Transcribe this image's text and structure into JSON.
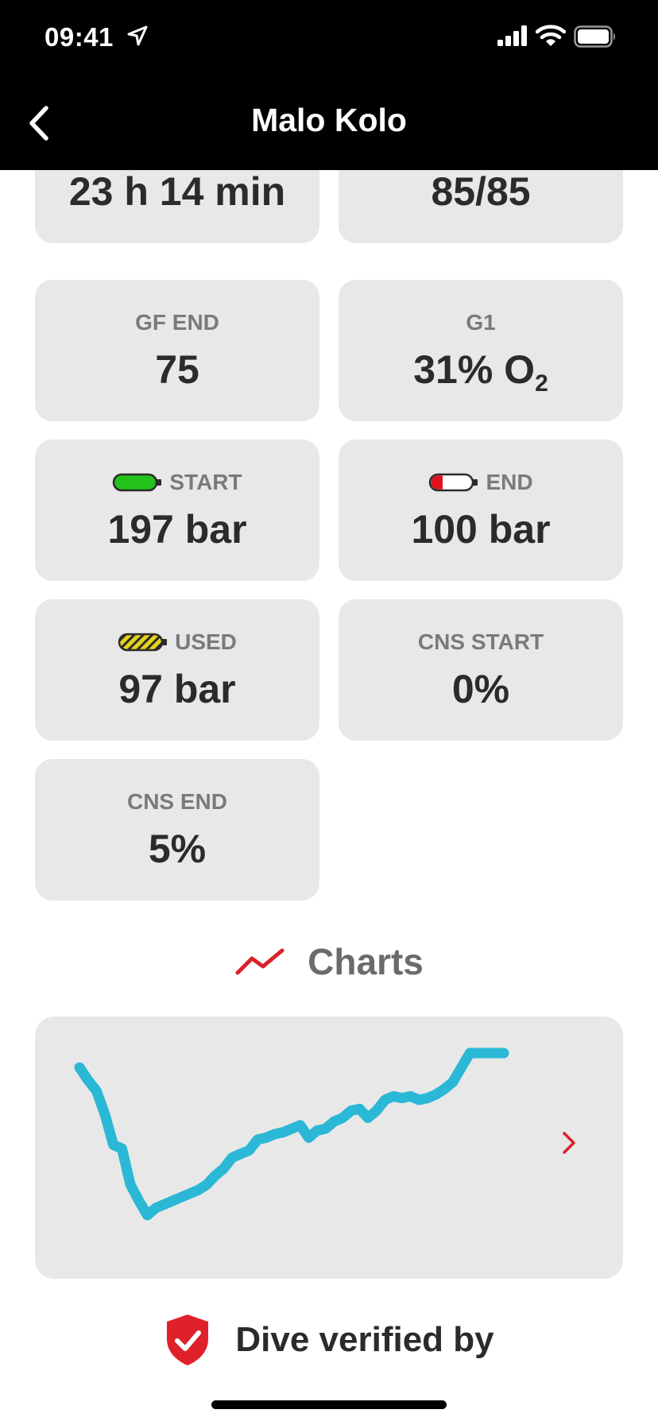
{
  "status": {
    "time": "09:41"
  },
  "nav": {
    "title": "Malo Kolo"
  },
  "tiles": [
    {
      "label": "",
      "value": "23 h 14 min"
    },
    {
      "label": "",
      "value": "85/85"
    },
    {
      "label": "GF END",
      "value": "75"
    },
    {
      "label": "G1",
      "value": "31% O",
      "value_sub": "2"
    },
    {
      "label": "START",
      "value": "197 bar",
      "icon": "tank-full-icon",
      "icon_color": "#22c21a"
    },
    {
      "label": "END",
      "value": "100 bar",
      "icon": "tank-low-icon",
      "icon_color": "#e0141e"
    },
    {
      "label": "USED",
      "value": "97 bar",
      "icon": "tank-used-icon",
      "icon_color": "#e6d21a"
    },
    {
      "label": "CNS START",
      "value": "0%"
    },
    {
      "label": "CNS END",
      "value": "5%"
    }
  ],
  "charts": {
    "title": "Charts",
    "icon": "trend-icon",
    "icon_color": "#d9222a",
    "line_color": "#2bb8d6"
  },
  "chart_data": {
    "type": "line",
    "title": "",
    "xlabel": "",
    "ylabel": "",
    "y_inverted": true,
    "series": [
      {
        "x": [
          0,
          2,
          4,
          6,
          8,
          10,
          12,
          14,
          16,
          18,
          20,
          22,
          24,
          26,
          28,
          30,
          32,
          34,
          36,
          38,
          40,
          42,
          44,
          46,
          48,
          50,
          52,
          54,
          56,
          58,
          60,
          62,
          64,
          66,
          68,
          70,
          72,
          74,
          76,
          78,
          80,
          82,
          84,
          86,
          88,
          90,
          92,
          94,
          96,
          98,
          100
        ],
        "y": [
          0,
          0.07,
          0.13,
          0.26,
          0.43,
          0.45,
          0.65,
          0.74,
          0.82,
          0.78,
          0.76,
          0.74,
          0.72,
          0.7,
          0.68,
          0.65,
          0.6,
          0.56,
          0.5,
          0.48,
          0.46,
          0.4,
          0.39,
          0.37,
          0.36,
          0.34,
          0.32,
          0.39,
          0.35,
          0.34,
          0.3,
          0.28,
          0.24,
          0.23,
          0.28,
          0.24,
          0.18,
          0.16,
          0.17,
          0.16,
          0.18,
          0.17,
          0.15,
          0.12,
          0.08,
          0.0,
          -0.08,
          -0.08,
          -0.08,
          -0.08,
          -0.08
        ]
      }
    ]
  },
  "footer": {
    "verified_text": "Dive verified by"
  }
}
